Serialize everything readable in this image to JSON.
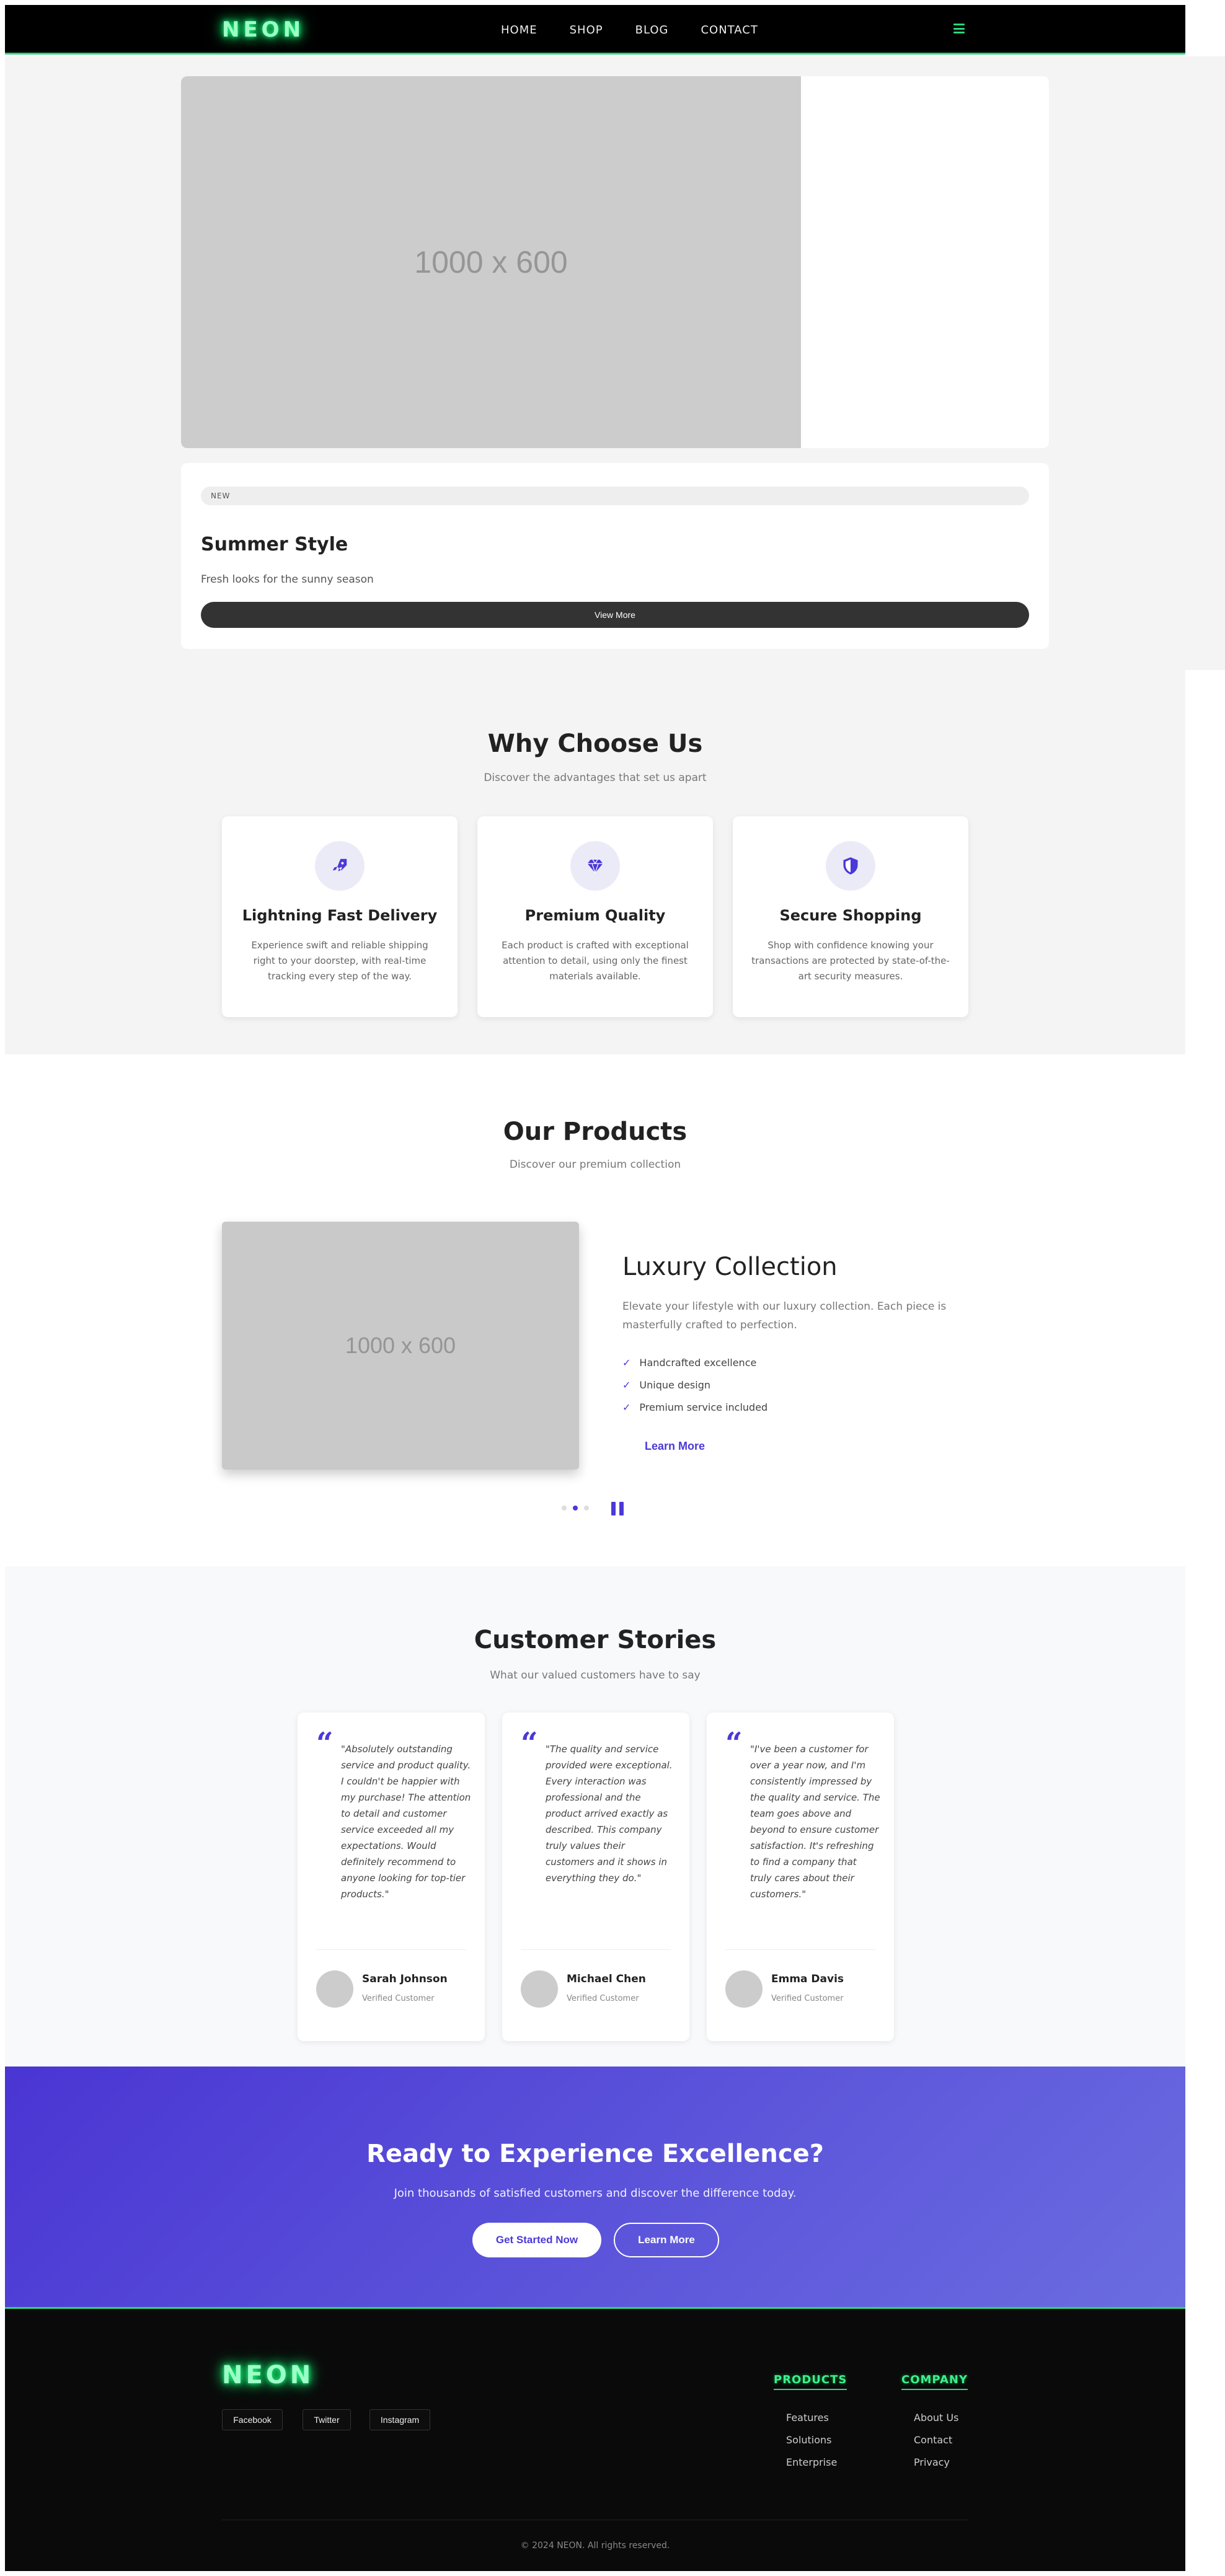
{
  "nav": {
    "logo": "NEON",
    "links": [
      "HOME",
      "SHOP",
      "BLOG",
      "CONTACT"
    ],
    "menu_icon": "hamburger-icon"
  },
  "hero": {
    "image_placeholder": "1000 x 600",
    "badge": "NEW",
    "title": "Summer Style",
    "subtitle": "Fresh looks for the sunny season",
    "button": "View More"
  },
  "why": {
    "title": "Why Choose Us",
    "subtitle": "Discover the advantages that set us apart",
    "features": [
      {
        "icon": "rocket-icon",
        "title": "Lightning Fast Delivery",
        "desc": "Experience swift and reliable shipping right to your doorstep, with real-time tracking every step of the way."
      },
      {
        "icon": "gem-icon",
        "title": "Premium Quality",
        "desc": "Each product is crafted with exceptional attention to detail, using only the finest materials available."
      },
      {
        "icon": "shield-icon",
        "title": "Secure Shopping",
        "desc": "Shop with confidence knowing your transactions are protected by state-of-the-art security measures."
      }
    ],
    "accent": "#4b39d8"
  },
  "products": {
    "title": "Our Products",
    "subtitle": "Discover our premium collection",
    "image_placeholder": "1000 x 600",
    "collection_title": "Luxury Collection",
    "collection_desc": "Elevate your lifestyle with our luxury collection. Each piece is masterfully crafted to perfection.",
    "features": [
      "Handcrafted excellence",
      "Unique design",
      "Premium service included"
    ],
    "learn_more": "Learn More",
    "slides_total": 3,
    "active_slide": 2
  },
  "testimonials": {
    "title": "Customer Stories",
    "subtitle": "What our valued customers have to say",
    "items": [
      {
        "quote": "\"Absolutely outstanding service and product quality. I couldn't be happier with my purchase! The attention to detail and customer service exceeded all my expectations. Would definitely recommend to anyone looking for top-tier products.\"",
        "name": "Sarah Johnson",
        "role": "Verified Customer"
      },
      {
        "quote": "\"The quality and service provided were exceptional. Every interaction was professional and the product arrived exactly as described. This company truly values their customers and it shows in everything they do.\"",
        "name": "Michael Chen",
        "role": "Verified Customer"
      },
      {
        "quote": "\"I've been a customer for over a year now, and I'm consistently impressed by the quality and service. The team goes above and beyond to ensure customer satisfaction. It's refreshing to find a company that truly cares about their customers.\"",
        "name": "Emma Davis",
        "role": "Verified Customer"
      }
    ]
  },
  "cta": {
    "title": "Ready to Experience Excellence?",
    "subtitle": "Join thousands of satisfied customers and discover the difference today.",
    "primary": "Get Started Now",
    "secondary": "Learn More"
  },
  "footer": {
    "logo": "NEON",
    "social": [
      "Facebook",
      "Twitter",
      "Instagram"
    ],
    "columns": [
      {
        "title": "PRODUCTS",
        "links": [
          "Features",
          "Solutions",
          "Enterprise"
        ]
      },
      {
        "title": "COMPANY",
        "links": [
          "About Us",
          "Contact",
          "Privacy"
        ]
      }
    ],
    "copyright": "© 2024 NEON. All rights reserved.",
    "neon_color": "#2bd47a"
  }
}
